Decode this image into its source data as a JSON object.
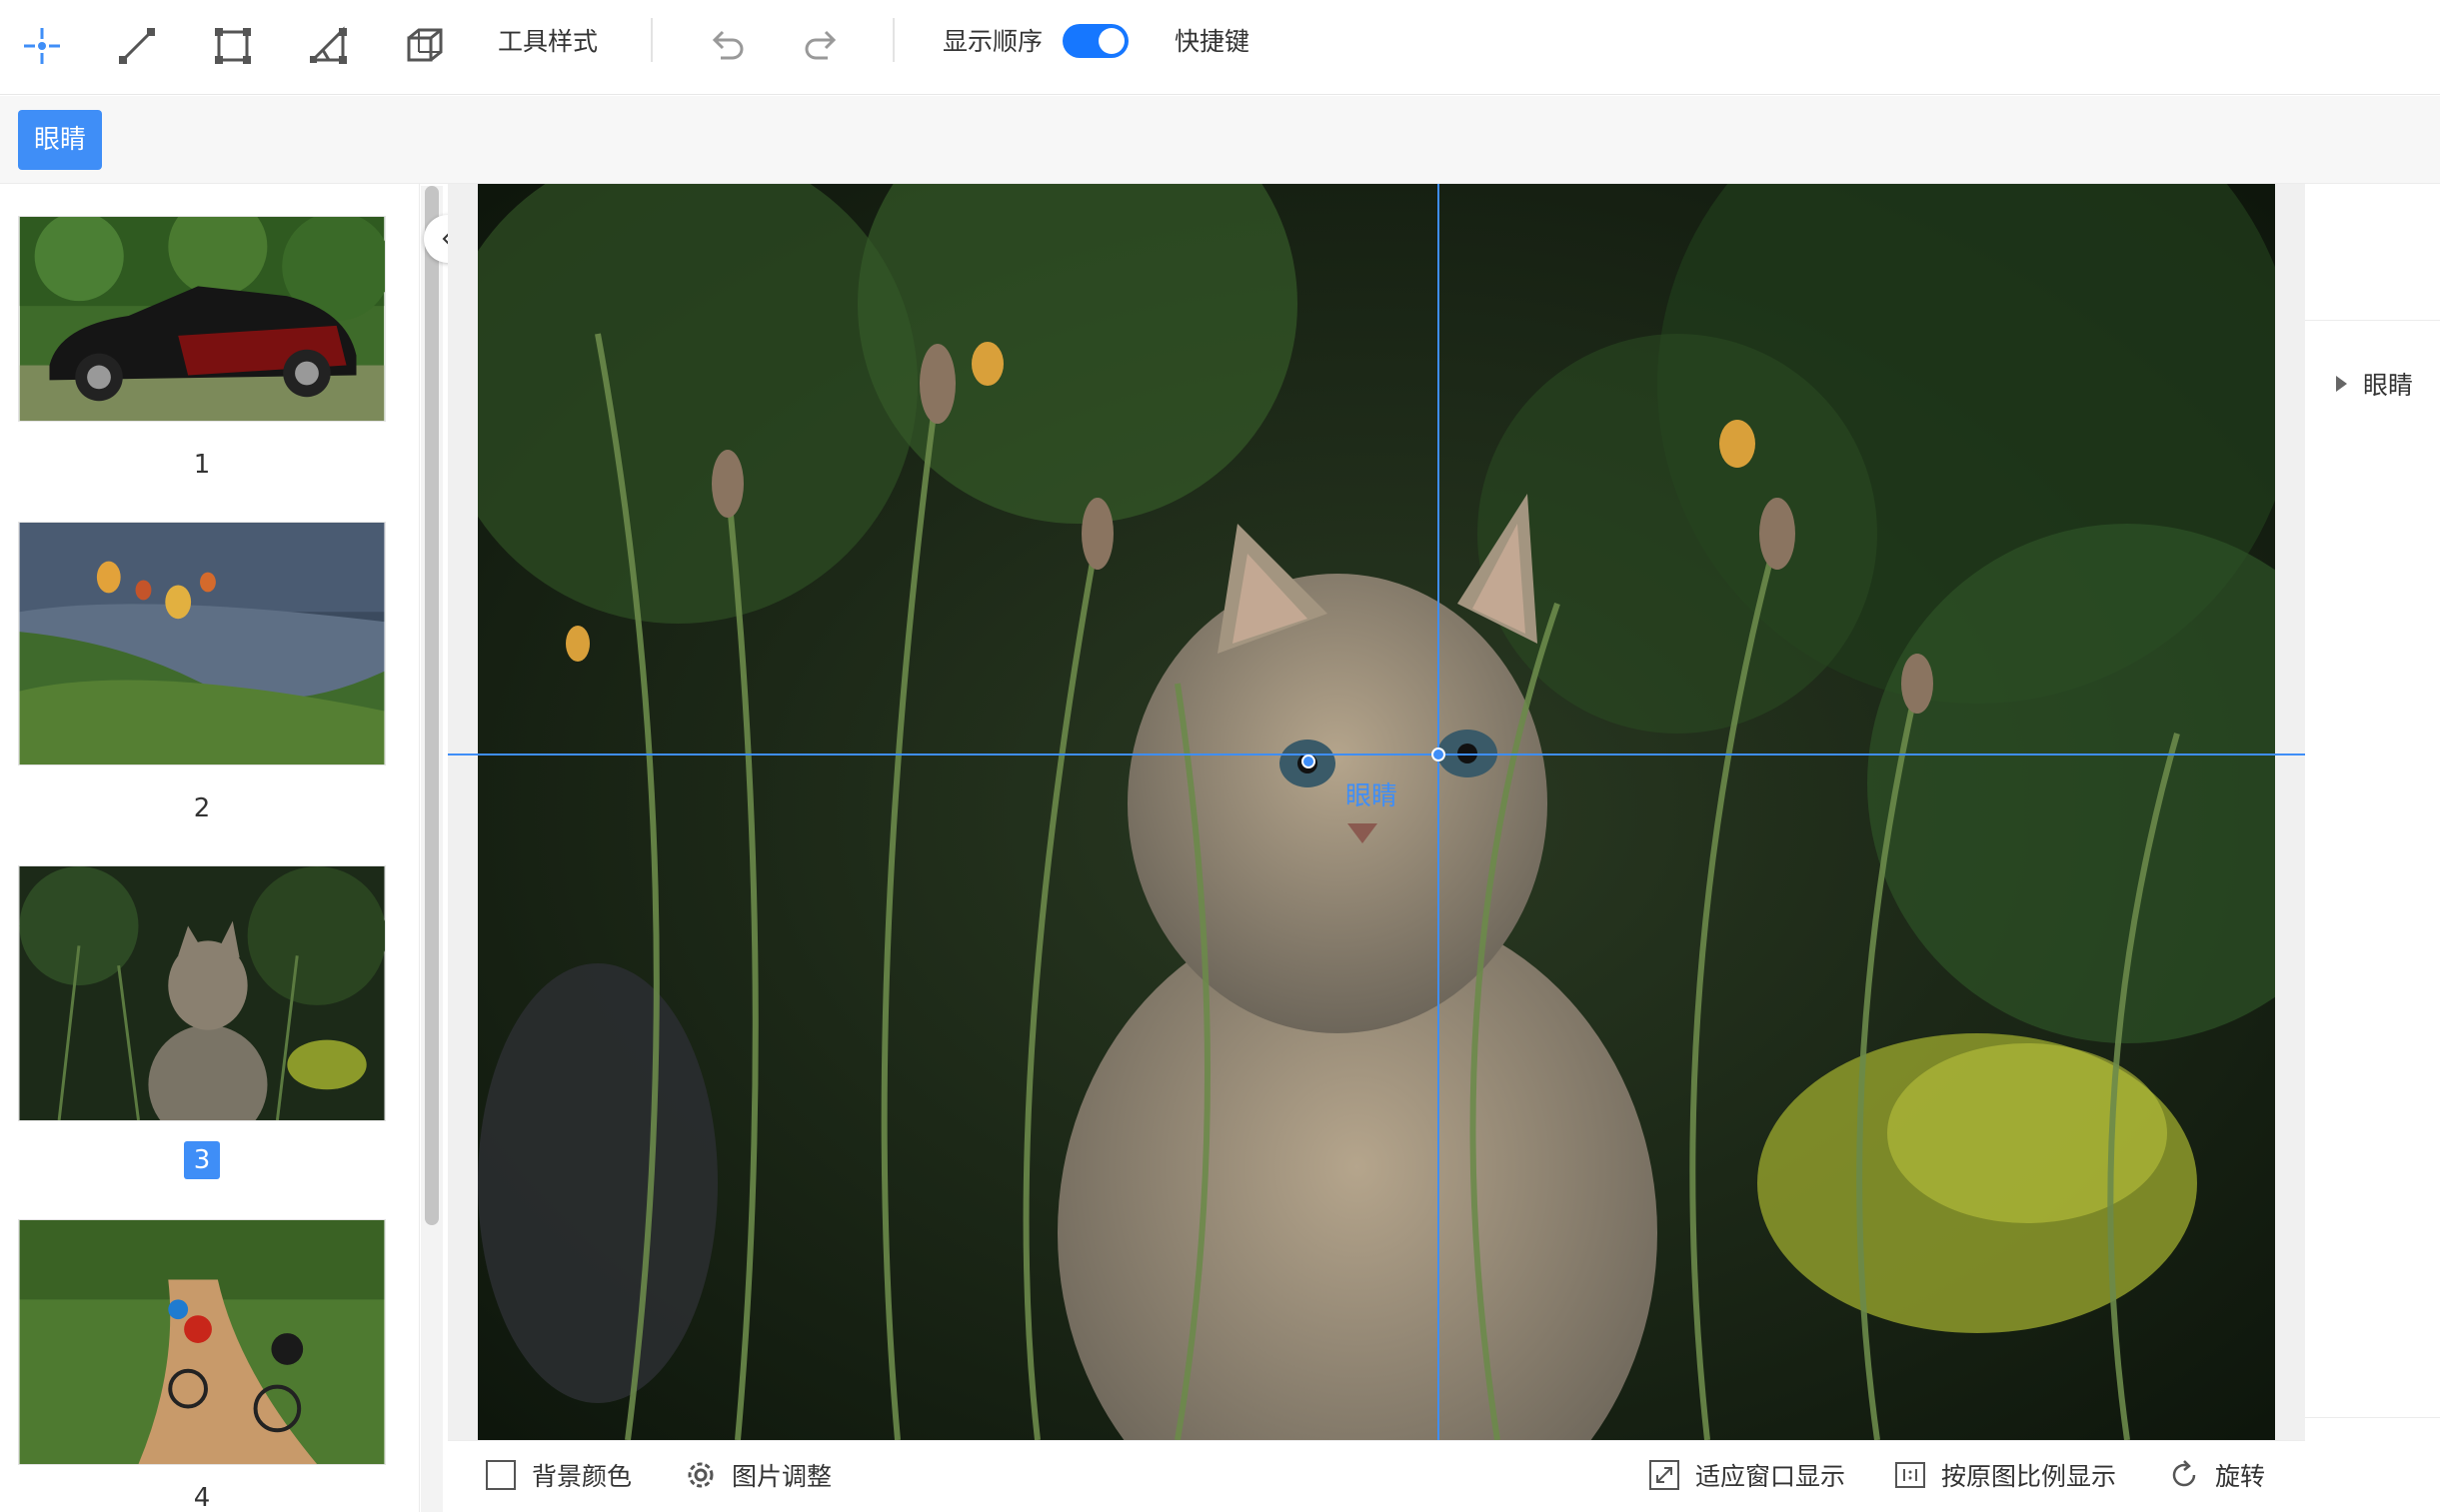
{
  "toolbar": {
    "tools": [
      "point-tool",
      "line-tool",
      "rect-tool",
      "polygon-tool",
      "cuboid-tool"
    ],
    "style_label": "工具样式",
    "show_order_label": "显示顺序",
    "show_order_on": true,
    "shortcut_label": "快捷键",
    "accent": "#3f8ef7"
  },
  "label_bar": {
    "active_label": "眼睛"
  },
  "thumbnails": [
    {
      "num": "1",
      "active": false
    },
    {
      "num": "2",
      "active": false
    },
    {
      "num": "3",
      "active": true
    },
    {
      "num": "4",
      "active": false
    }
  ],
  "canvas": {
    "point_label": "眼睛"
  },
  "bottom": {
    "bg_color_label": "背景颜色",
    "image_adjust_label": "图片调整",
    "fit_window_label": "适应窗口显示",
    "original_ratio_label": "按原图比例显示",
    "rotate_label": "旋转"
  },
  "right_panel": {
    "label_item": "眼睛"
  }
}
